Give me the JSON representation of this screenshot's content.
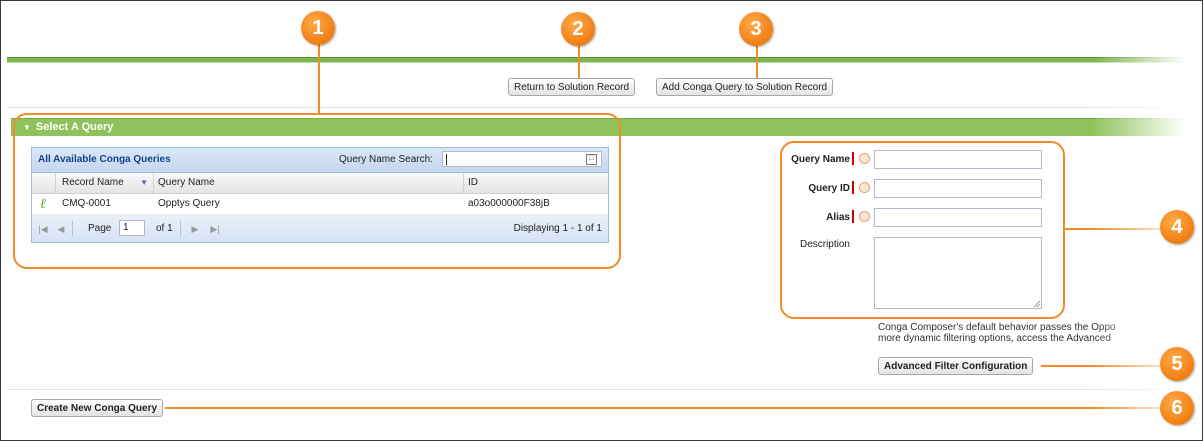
{
  "toolbar": {
    "return_label": "Return to Solution Record",
    "add_label": "Add Conga Query to Solution Record"
  },
  "section": {
    "title": "Select A Query"
  },
  "grid": {
    "title": "All Available Conga Queries",
    "search_label": "Query Name Search:",
    "search_value": "",
    "columns": [
      "Record Name",
      "Query Name",
      "ID"
    ],
    "rows": [
      {
        "record_name": "CMQ-0001",
        "query_name": "Opptys Query",
        "id": "a03o000000F38jB"
      }
    ],
    "paging": {
      "page_label": "Page",
      "page_value": "1",
      "of_label": "of 1",
      "displaying": "Displaying 1 - 1 of 1"
    }
  },
  "form": {
    "query_name_label": "Query Name",
    "query_id_label": "Query ID",
    "alias_label": "Alias",
    "description_label": "Description",
    "query_name_value": "",
    "query_id_value": "",
    "alias_value": "",
    "description_value": ""
  },
  "note": {
    "line1": "Conga Composer's default behavior passes the Oppo",
    "line2": "more dynamic filtering options, access the Advanced"
  },
  "buttons": {
    "advanced_filter_label": "Advanced Filter Configuration",
    "create_query_label": "Create New Conga Query"
  },
  "callouts": [
    "1",
    "2",
    "3",
    "4",
    "5",
    "6"
  ],
  "colors": {
    "callout": "#f28c28",
    "section_header": "#8fc25a",
    "grid_title": "#15428b"
  }
}
